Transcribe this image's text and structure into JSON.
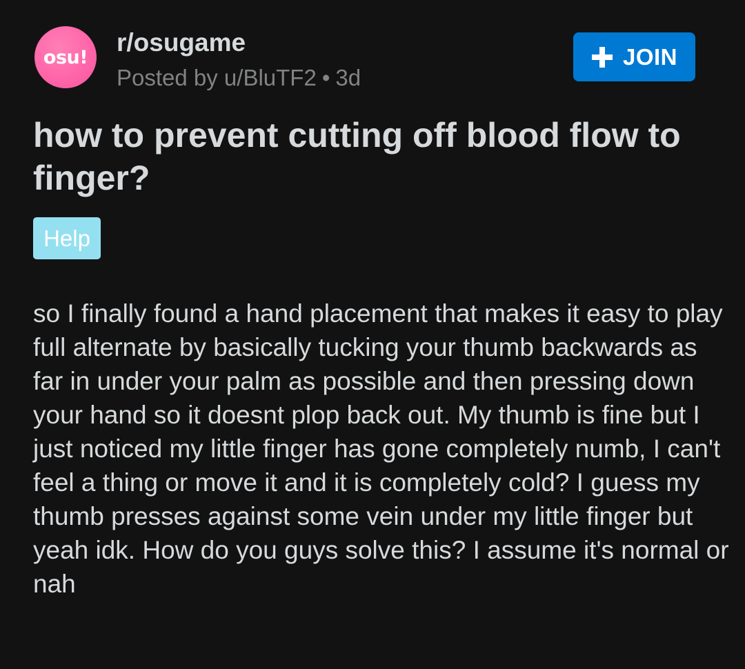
{
  "post": {
    "avatar_text": "osu!",
    "subreddit": "r/osugame",
    "posted_by": "Posted by u/BluTF2",
    "separator": "•",
    "age": "3d",
    "join_label": "JOIN",
    "title": "how to prevent cutting off blood flow to finger?",
    "flair": "Help",
    "body": "so I finally found a hand placement that makes it easy to play full alternate by basically tucking your thumb backwards as far in under your palm as possible and then pressing down your hand so it doesnt plop back out.  My thumb is fine but I just noticed my little finger has gone completely numb, I can't feel a thing or move it and it is completely cold? I guess my thumb presses against some vein under my little finger but yeah idk. How do you guys solve this? I assume it's normal or nah"
  },
  "colors": {
    "background": "#121212",
    "primary_text": "#d7dadc",
    "secondary_text": "#818384",
    "join_button": "#0079d3",
    "flair_background": "#94e0f0",
    "avatar": "#ff66aa"
  },
  "icons": {
    "join": "plus-icon"
  }
}
